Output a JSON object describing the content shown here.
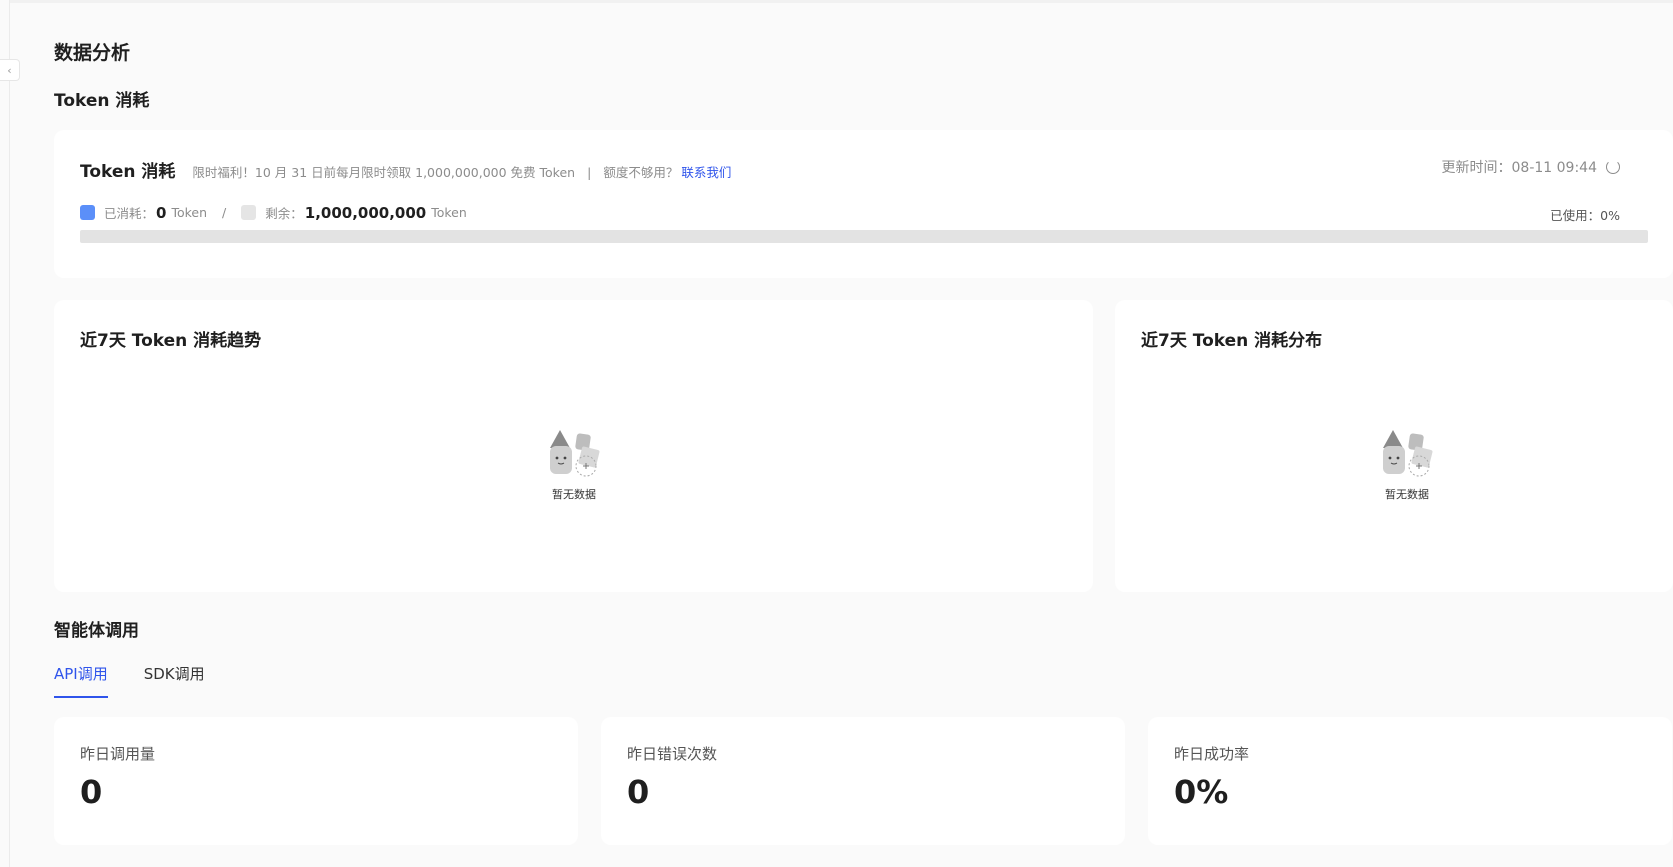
{
  "page": {
    "title": "数据分析"
  },
  "token_section": {
    "heading": "Token 消耗",
    "card": {
      "title": "Token 消耗",
      "promo": "限时福利！10 月 31 日前每月限时领取 1,000,000,000 免费 Token",
      "separator": "|",
      "quota_question": "额度不够用？",
      "contact_link": "联系我们",
      "update_label": "更新时间：08-11 09:44",
      "used_label": "已消耗：",
      "used_value": "0",
      "used_unit": "Token",
      "slash": "/",
      "remain_label": "剩余：",
      "remain_value": "1,000,000,000",
      "remain_unit": "Token",
      "usage_percent_label": "已使用：0%",
      "usage_fraction": 0,
      "colors": {
        "used": "#5b8ff9",
        "remain": "#e5e5e5"
      }
    }
  },
  "charts": {
    "trend": {
      "title": "近7天 Token 消耗趋势",
      "empty_text": "暂无数据"
    },
    "distribution": {
      "title": "近7天 Token 消耗分布",
      "empty_text": "暂无数据"
    }
  },
  "agent_section": {
    "heading": "智能体调用",
    "tabs": [
      {
        "label": "API调用",
        "active": true
      },
      {
        "label": "SDK调用",
        "active": false
      }
    ],
    "stats": [
      {
        "label": "昨日调用量",
        "value": "0"
      },
      {
        "label": "昨日错误次数",
        "value": "0"
      },
      {
        "label": "昨日成功率",
        "value": "0%"
      }
    ]
  },
  "icons": {
    "collapse": "chevron-left-icon",
    "refresh": "refresh-icon",
    "empty": "empty-illustration-icon"
  },
  "accent_color": "#2f54eb"
}
